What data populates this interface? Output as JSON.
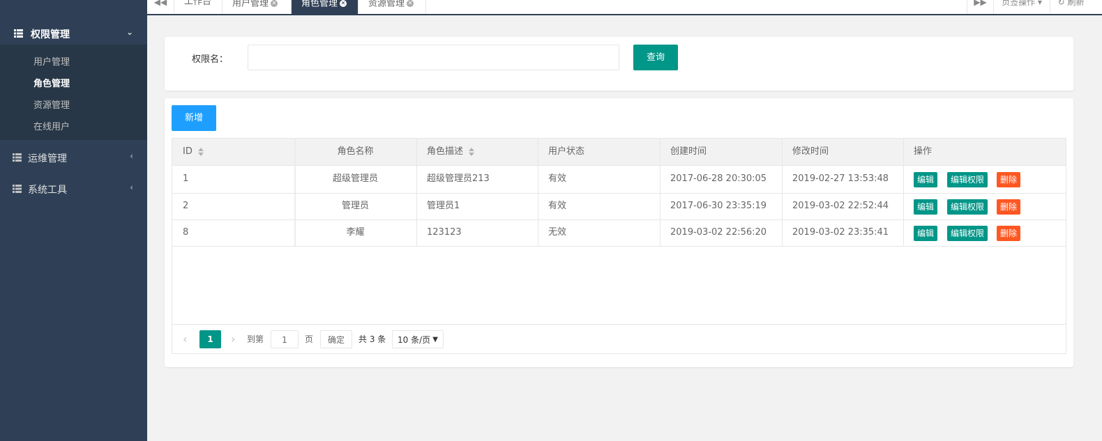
{
  "sidebar": {
    "groups": [
      {
        "label": "权限管理",
        "expanded": true,
        "items": [
          "用户管理",
          "角色管理",
          "资源管理",
          "在线用户"
        ],
        "active_item": "角色管理"
      },
      {
        "label": "运维管理",
        "expanded": false
      },
      {
        "label": "系统工具",
        "expanded": false
      }
    ]
  },
  "tabbar": {
    "prev": "◀◀",
    "tabs": [
      "工作台",
      "用户管理",
      "角色管理",
      "资源管理"
    ],
    "active_tab": "角色管理",
    "next": "▶▶",
    "page_ops": "页签操作",
    "refresh": "刷新"
  },
  "search": {
    "label": "权限名：",
    "value": "",
    "query_button": "查询"
  },
  "toolbar": {
    "add_button": "新增"
  },
  "table": {
    "columns": [
      "ID",
      "角色名称",
      "角色描述",
      "用户状态",
      "创建时间",
      "修改时间",
      "操作"
    ],
    "rows": [
      {
        "id": "1",
        "name": "超级管理员",
        "desc": "超级管理员213",
        "status": "有效",
        "created": "2017-06-28 20:30:05",
        "modified": "2019-02-27 13:53:48"
      },
      {
        "id": "2",
        "name": "管理员",
        "desc": "管理员1",
        "status": "有效",
        "created": "2017-06-30 23:35:19",
        "modified": "2019-03-02 22:52:44"
      },
      {
        "id": "8",
        "name": "李耀",
        "desc": "123123",
        "status": "无效",
        "created": "2019-03-02 22:56:20",
        "modified": "2019-03-02 23:35:41"
      }
    ],
    "actions": {
      "edit": "编辑",
      "edit_perm": "编辑权限",
      "delete": "删除"
    }
  },
  "pagination": {
    "current_page": "1",
    "goto_label": "到第",
    "goto_value": "1",
    "page_unit": "页",
    "confirm": "确定",
    "total": "共 3 条",
    "page_size": "10 条/页"
  },
  "colors": {
    "sidebar": "#2f4056",
    "submenu": "#283747",
    "primary": "#009688",
    "blue": "#1e9fff",
    "danger": "#ff5722"
  }
}
